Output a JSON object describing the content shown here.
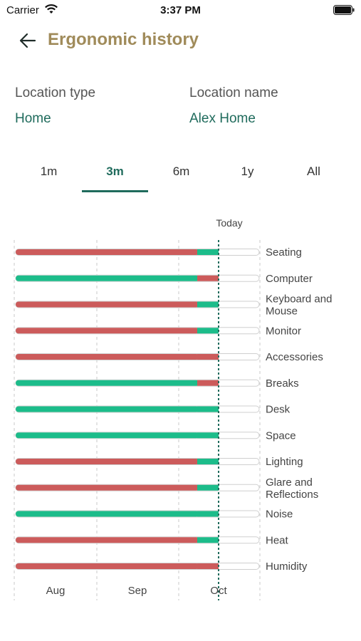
{
  "status": {
    "carrier": "Carrier",
    "time": "3:37 PM"
  },
  "header": {
    "title": "Ergonomic history"
  },
  "location": {
    "type_label": "Location type",
    "type_value": "Home",
    "name_label": "Location name",
    "name_value": "Alex Home"
  },
  "tabs": [
    {
      "label": "1m",
      "active": false
    },
    {
      "label": "3m",
      "active": true
    },
    {
      "label": "6m",
      "active": false
    },
    {
      "label": "1y",
      "active": false
    },
    {
      "label": "All",
      "active": false
    }
  ],
  "colors": {
    "good": "#1cbc8a",
    "bad": "#cc5b5b",
    "accent": "#1f6b5c",
    "title": "#a08b5a"
  },
  "chart_data": {
    "type": "timeline",
    "today_label": "Today",
    "x_labels": [
      "Aug",
      "Sep",
      "Oct"
    ],
    "rows": [
      {
        "name": "Seating",
        "segments": [
          "bad",
          "good"
        ]
      },
      {
        "name": "Computer",
        "segments": [
          "good",
          "bad"
        ]
      },
      {
        "name": "Keyboard and Mouse",
        "segments": [
          "bad",
          "good"
        ]
      },
      {
        "name": "Monitor",
        "segments": [
          "bad",
          "good"
        ]
      },
      {
        "name": "Accessories",
        "segments": [
          "bad",
          "bad"
        ]
      },
      {
        "name": "Breaks",
        "segments": [
          "good",
          "bad"
        ]
      },
      {
        "name": "Desk",
        "segments": [
          "good",
          "good"
        ]
      },
      {
        "name": "Space",
        "segments": [
          "good",
          "good"
        ]
      },
      {
        "name": "Lighting",
        "segments": [
          "bad",
          "good"
        ]
      },
      {
        "name": "Glare and Reflections",
        "segments": [
          "bad",
          "good"
        ]
      },
      {
        "name": "Noise",
        "segments": [
          "good",
          "good"
        ]
      },
      {
        "name": "Heat",
        "segments": [
          "bad",
          "good"
        ]
      },
      {
        "name": "Humidity",
        "segments": [
          "bad",
          "bad"
        ]
      }
    ]
  }
}
